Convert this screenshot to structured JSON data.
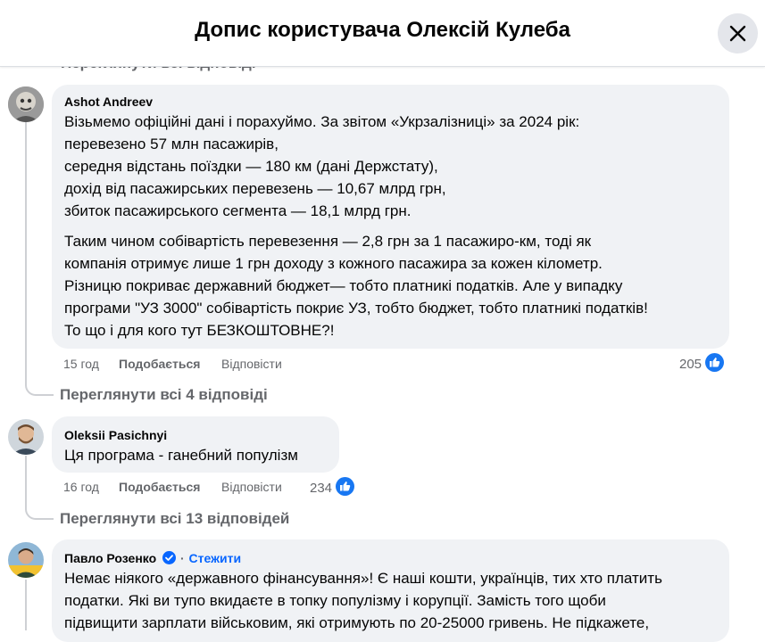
{
  "header": {
    "title": "Допис користувача Олексій Кулеба"
  },
  "scrolled_label": "Переглянути всі відповіді",
  "comments": [
    {
      "author": "Ashot Andreev",
      "lines": [
        "Візьмемо офіційні дані і порахуймо. За звітом «Укрзалізниці» за 2024 рік:",
        "перевезено 57 млн пасажирів,",
        "середня відстань поїздки — 180 км (дані Держстату),",
        "дохід від пасажирських перевезень — 10,67 млрд грн,",
        "збиток пасажирського сегмента — 18,1 млрд грн."
      ],
      "lines2": [
        "Таким чином собівартість перевезення — 2,8 грн за 1 пасажиро-км, тоді як",
        "компанія отримує лише 1 грн доходу з кожного пасажира за кожен кілометр.",
        "Різницю покриває державний бюджет— тобто платникі податків. Але у випадку",
        "програми \"УЗ 3000\" собівартість покриє УЗ, тобто бюджет, тобто платникі податків!",
        "То що і для кого тут БЕЗКОШТОВНЕ?!"
      ],
      "time": "15 год",
      "like_label": "Подобається",
      "reply_label": "Відповісти",
      "reactions": "205",
      "view_replies": "Переглянути всі 4 відповіді"
    },
    {
      "author": "Oleksii Pasichnyi",
      "text": "Ця програма - ганебний популізм",
      "time": "16 год",
      "like_label": "Подобається",
      "reply_label": "Відповісти",
      "reactions": "234",
      "view_replies": "Переглянути всі 13 відповідей"
    },
    {
      "author": "Павло Розенко",
      "follow_label": "Стежити",
      "lines": [
        "Немає ніякого «державного фінансування»! Є наші кошти, українців, тих хто платить",
        "податки. Які ви тупо вкидаєте в топку популізму і корупції. Замість того щоби",
        "підвищити зарплати військовим, які отримують по 20-25000 гривень. Не підкажете,"
      ]
    }
  ],
  "colors": {
    "accent": "#0866ff",
    "bubble": "#f0f2f5",
    "muted": "#65676b"
  }
}
